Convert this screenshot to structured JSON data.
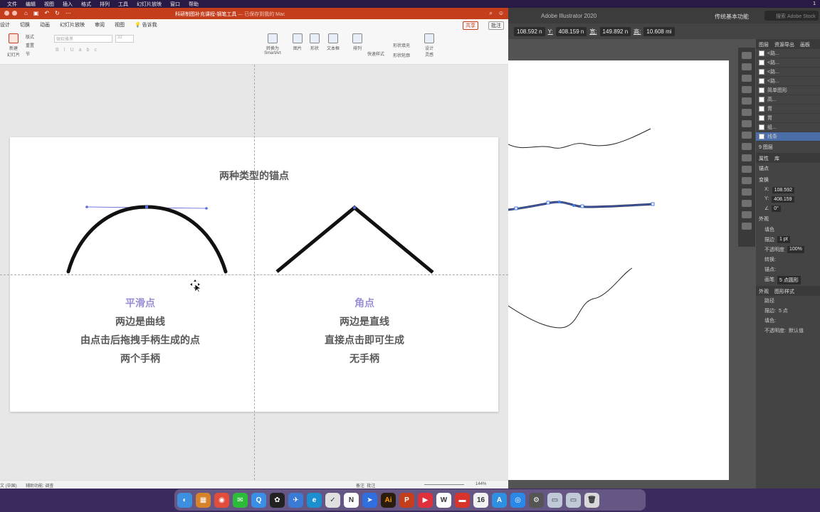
{
  "menubar": {
    "items": [
      "文件",
      "编辑",
      "视图",
      "插入",
      "格式",
      "排列",
      "工具",
      "幻灯片放映",
      "窗口",
      "帮助"
    ],
    "right": "1"
  },
  "ppt": {
    "doc_title": "科研制图补充课程-钢笔工具",
    "doc_status": " — 已保存到我的 Mac",
    "tabs": [
      "设计",
      "切换",
      "动画",
      "幻灯片放映",
      "审阅",
      "视图",
      "告诉我"
    ],
    "share": "共享",
    "comment": "批注",
    "ribbon": {
      "new_slide": "新建\n幻灯片",
      "layout": "版式",
      "reset": "重置",
      "section": "节",
      "font_name": "微软雅黑",
      "font_size": "32",
      "smartart": "转换为\nSmartArt",
      "picture": "图片",
      "shape": "形状",
      "textbox": "文本框",
      "arrange": "排列",
      "quick_styles": "快速样式",
      "shape_fill": "形状填充",
      "shape_outline": "形状轮廓",
      "designer": "设计\n灵感"
    },
    "slide": {
      "title": "两种类型的锚点",
      "left_heading": "平滑点",
      "left_lines": [
        "两边是曲线",
        "由点击后拖拽手柄生成的点",
        "两个手柄"
      ],
      "right_heading": "角点",
      "right_lines": [
        "两边是直线",
        "直接点击即可生成",
        "无手柄"
      ]
    },
    "status": {
      "language": "文 (中国)",
      "accessibility": "辅助功能: 调查",
      "notes": "备注",
      "comments": "批注",
      "zoom": "144%"
    },
    "colors": {
      "accent": "#c43e1c",
      "heading": "#9b8fd6",
      "body_text": "#595959"
    }
  },
  "illustrator": {
    "app_title": "Adobe Illustrator 2020",
    "workspace": "传统基本功能",
    "search_placeholder": "搜索 Adobe Stock",
    "control_bar": {
      "x_value": "108.592 n",
      "y_label": "Y:",
      "y_value": "408.159 n",
      "w_label": "宽:",
      "w_value": "149.892 n",
      "h_label": "高:",
      "h_value": "10.608 mi"
    },
    "layers_panel": {
      "tabs": [
        "图层",
        "资源导出",
        "画板"
      ],
      "rows": [
        "<路...",
        "<路...",
        "<路...",
        "<路...",
        "简单图形",
        "高...",
        "胃",
        "胃",
        "组...",
        "线条"
      ],
      "layer_count": "9 图层"
    },
    "properties_panel": {
      "tabs": [
        "属性",
        "库"
      ],
      "anchor_label": "锚点",
      "transform_label": "变换",
      "x": "108.592",
      "y": "408.159",
      "angle": "0°",
      "appearance_label": "外观",
      "fill_label": "填色",
      "stroke_label": "描边",
      "stroke_value": "1 pt",
      "opacity_label": "不透明度",
      "opacity_value": "100%",
      "convert_label": "转换:",
      "anchor_point_label": "锚点:",
      "brush_label": "画笔",
      "brush_value": "5 点圆形"
    },
    "appearance_panel": {
      "tabs": [
        "外观",
        "图形样式"
      ],
      "path_label": "路径",
      "stroke_label": "描边:",
      "stroke_value": "5 点",
      "fill_label": "填色:",
      "opacity_label": "不透明度:",
      "opacity_value": "默认值"
    }
  },
  "dock": {
    "apps": [
      {
        "name": "finder-icon",
        "color": "#3d8fe0",
        "glyph": "◐"
      },
      {
        "name": "launchpad-icon",
        "color": "#d6822b",
        "glyph": "▦"
      },
      {
        "name": "chrome-icon",
        "color": "#e24c3b",
        "glyph": "◉"
      },
      {
        "name": "wechat-icon",
        "color": "#2dbb3a",
        "glyph": "✉"
      },
      {
        "name": "qq-browser-icon",
        "color": "#3a8ee6",
        "glyph": "Q"
      },
      {
        "name": "qq-icon",
        "color": "#222222",
        "glyph": "✿"
      },
      {
        "name": "mail-icon",
        "color": "#3a7bd5",
        "glyph": "✈"
      },
      {
        "name": "edge-icon",
        "color": "#1b8fcf",
        "glyph": "e"
      },
      {
        "name": "tasks-icon",
        "color": "#e0e0e0",
        "glyph": "✓"
      },
      {
        "name": "notion-icon",
        "color": "#ffffff",
        "glyph": "N"
      },
      {
        "name": "feishu-icon",
        "color": "#2f6fe0",
        "glyph": "➤"
      },
      {
        "name": "illustrator-icon",
        "color": "#2b1d0e",
        "glyph": "Ai"
      },
      {
        "name": "powerpoint-icon",
        "color": "#c43e1c",
        "glyph": "P"
      },
      {
        "name": "infuse-icon",
        "color": "#e0303a",
        "glyph": "▶"
      },
      {
        "name": "word-app-icon",
        "color": "#ffffff",
        "glyph": "W"
      },
      {
        "name": "present-icon",
        "color": "#d9342b",
        "glyph": "▬"
      },
      {
        "name": "calendar-icon",
        "color": "#f2f2f2",
        "glyph": "16"
      },
      {
        "name": "translate-icon",
        "color": "#2f8fe0",
        "glyph": "A"
      },
      {
        "name": "safari-icon",
        "color": "#2a88e8",
        "glyph": "◎"
      },
      {
        "name": "system-prefs-icon",
        "color": "#555555",
        "glyph": "⚙"
      },
      {
        "name": "folder-icon",
        "color": "#c0c9d8",
        "glyph": "▭"
      },
      {
        "name": "downloads-icon",
        "color": "#c0c9d8",
        "glyph": "▭"
      },
      {
        "name": "trash-icon",
        "color": "#d8d8d8",
        "glyph": "🗑"
      }
    ]
  }
}
